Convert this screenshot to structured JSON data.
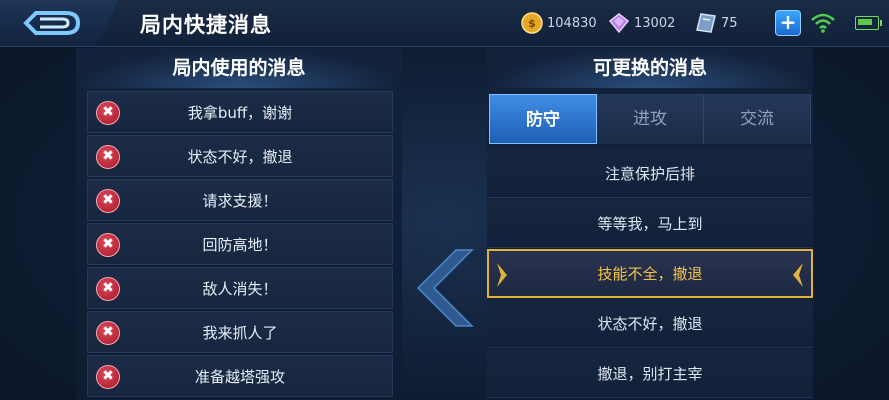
{
  "header": {
    "title": "局内快捷消息",
    "gold": "104830",
    "diamonds": "13002",
    "vouchers": "75"
  },
  "left_panel": {
    "title": "局内使用的消息",
    "delete_symbol": "✖",
    "items": [
      {
        "label": "我拿buff，谢谢"
      },
      {
        "label": "状态不好，撤退"
      },
      {
        "label": "请求支援！"
      },
      {
        "label": "回防高地！"
      },
      {
        "label": "敌人消失！"
      },
      {
        "label": "我来抓人了"
      },
      {
        "label": "准备越塔强攻"
      }
    ]
  },
  "right_panel": {
    "title": "可更换的消息",
    "tabs": [
      {
        "label": "防守",
        "active": true
      },
      {
        "label": "进攻",
        "active": false
      },
      {
        "label": "交流",
        "active": false
      }
    ],
    "items": [
      {
        "label": "注意保护后排",
        "selected": false
      },
      {
        "label": "等等我，马上到",
        "selected": false
      },
      {
        "label": "技能不全，撤退",
        "selected": true
      },
      {
        "label": "状态不好，撤退",
        "selected": false
      },
      {
        "label": "撤退，别打主宰",
        "selected": false
      }
    ]
  },
  "colors": {
    "accent_blue": "#3f8de6",
    "selected_gold": "#e0b23a",
    "delete_red": "#c02a3c"
  },
  "icons": {
    "back": "back-arrow-icon",
    "gold": "gold-coin-icon",
    "diamond": "diamond-icon",
    "voucher": "voucher-icon",
    "add": "plus-icon",
    "wifi": "wifi-icon",
    "battery": "battery-icon",
    "delete": "delete-x-icon",
    "transfer": "chevron-left-icon"
  }
}
